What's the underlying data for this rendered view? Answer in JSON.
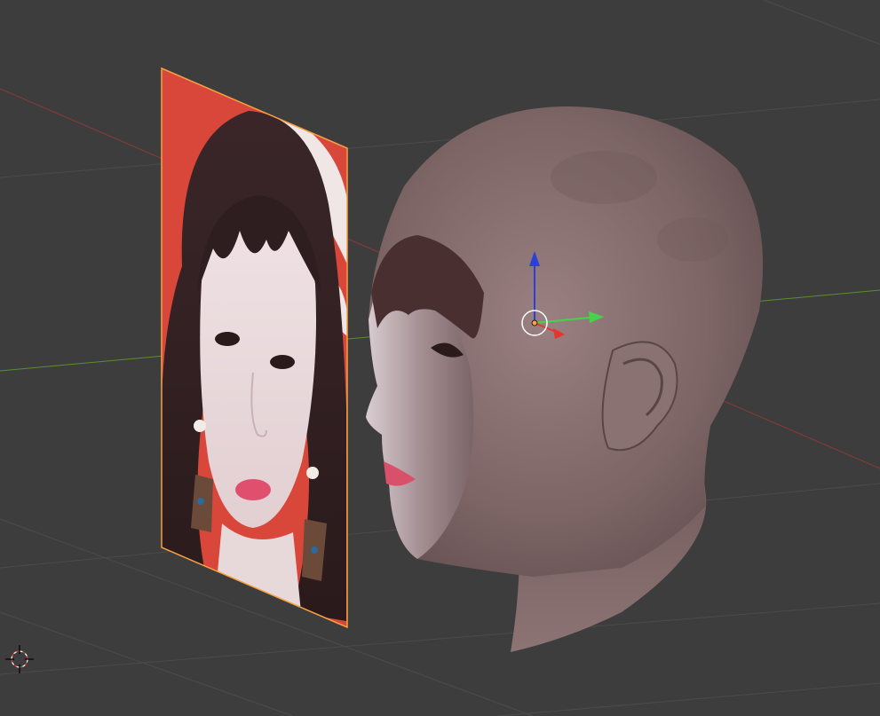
{
  "viewport": {
    "kind": "3d-viewport",
    "background_color": "#3d3d3d",
    "grid_color": "#4b4b4b",
    "x_axis_color": "#8e3a3a",
    "y_axis_color": "#5b8f2e"
  },
  "objects": [
    {
      "name": "reference-image-plane",
      "selected": true,
      "outline_color": "#f5a042",
      "backdrop_color": "#d9473a"
    },
    {
      "name": "head-mesh",
      "selected": false,
      "skin_color": "#8a7070"
    }
  ],
  "manipulator": {
    "x_axis_color": "#e8332e",
    "y_axis_color": "#45d447",
    "z_axis_color": "#2c3fd8",
    "pivot_color": "#ffffff"
  },
  "cursor_3d": {
    "color": "#ffffff",
    "accent_color": "#e8332e"
  }
}
